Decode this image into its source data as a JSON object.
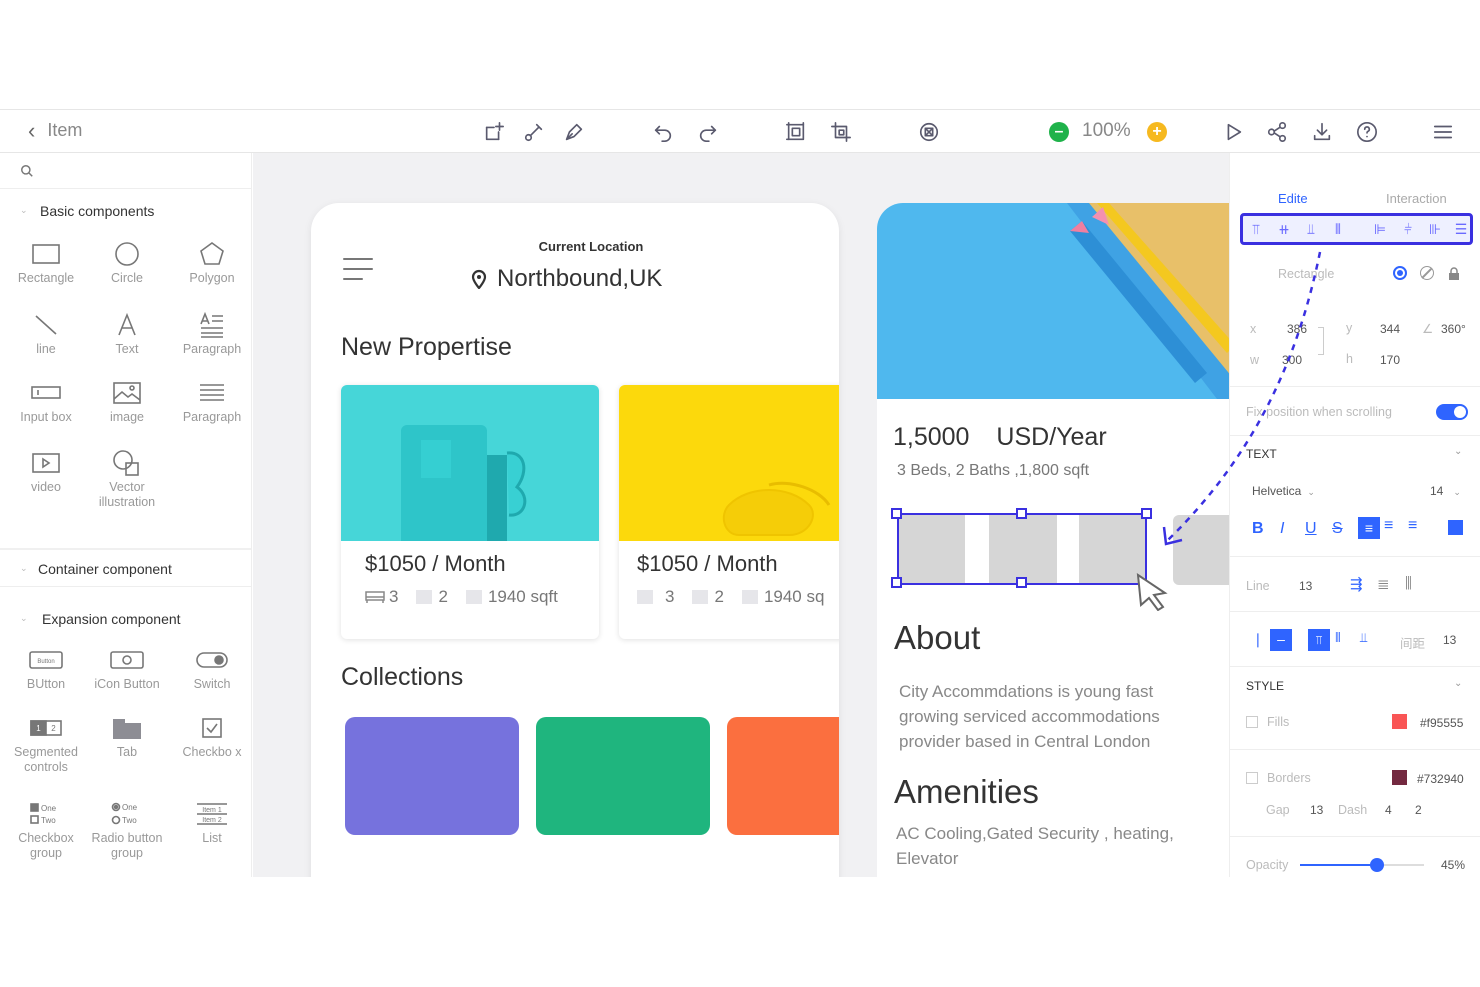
{
  "toolbar": {
    "back_label": "Item",
    "zoom": "100%",
    "icons": [
      "add-artboard-icon",
      "pen-icon",
      "brush-icon",
      "undo-icon",
      "redo-icon",
      "frame-icon",
      "crop-icon",
      "component-icon",
      "zoom-out-icon",
      "zoom-in-icon",
      "play-icon",
      "share-icon",
      "download-icon",
      "help-icon",
      "menu-icon"
    ]
  },
  "sidebar": {
    "basic_title": "Basic components",
    "basic_items": [
      {
        "label": "Rectangle",
        "icon": "rectangle-icon"
      },
      {
        "label": "Circle",
        "icon": "circle-icon"
      },
      {
        "label": "Polygon",
        "icon": "polygon-icon"
      },
      {
        "label": "line",
        "icon": "line-icon"
      },
      {
        "label": "Text",
        "icon": "text-icon"
      },
      {
        "label": "Paragraph",
        "icon": "paragraph-icon"
      },
      {
        "label": "Input box",
        "icon": "input-box-icon"
      },
      {
        "label": "image",
        "icon": "image-icon"
      },
      {
        "label": "Paragraph",
        "icon": "paragraph-lines-icon"
      },
      {
        "label": "video",
        "icon": "video-icon"
      },
      {
        "label": "Vector illustration",
        "icon": "vector-icon"
      }
    ],
    "container_title": "Container component",
    "expansion_title": "Expansion component",
    "expansion_items": [
      {
        "label": "BUtton",
        "icon": "button-icon",
        "inner": "Button"
      },
      {
        "label": "iCon Button",
        "icon": "icon-button-icon"
      },
      {
        "label": "Switch",
        "icon": "switch-icon"
      },
      {
        "label": "Segmented controls",
        "icon": "segmented-icon",
        "inner": [
          "1",
          "2"
        ]
      },
      {
        "label": "Tab",
        "icon": "tab-icon"
      },
      {
        "label": "Checkbo x",
        "icon": "checkbox-icon"
      },
      {
        "label": "Checkbox group",
        "icon": "checkbox-group-icon",
        "inner": [
          "One",
          "Two"
        ]
      },
      {
        "label": "Radio button group",
        "icon": "radio-group-icon",
        "inner": [
          "One",
          "Two"
        ]
      },
      {
        "label": "List",
        "icon": "list-icon",
        "inner": [
          "Item 1",
          "Item 2"
        ]
      }
    ]
  },
  "phone1": {
    "location_label": "Current Location",
    "location": "Northbound,UK",
    "section_title": "New Propertise",
    "cards": [
      {
        "price": "$1050 / Month",
        "beds": "3",
        "baths": "2",
        "area": "1940 sqft",
        "color": "#46d6d8"
      },
      {
        "price": "$1050 / Month",
        "beds": "3",
        "baths": "2",
        "area": "1940 sq",
        "color": "#fcd90c"
      }
    ],
    "collections_title": "Collections",
    "collection_colors": [
      "#7672dd",
      "#1fb57e",
      "#fb6f3f"
    ]
  },
  "phone2": {
    "price": "1,5000",
    "period": "USD/Year",
    "details": "3 Beds, 2 Baths ,1,800 sqft",
    "about_title": "About",
    "about_text": "City Accommdations  is young fast growing serviced accommodations provider based in Central London",
    "amenities_title": "Amenities",
    "amenities_text": "AC Cooling,Gated Security , heating, Elevator"
  },
  "panel": {
    "tab_edit": "Edite",
    "tab_interaction": "Interaction",
    "element_name": "Rectangle",
    "x_label": "x",
    "x_value": "386",
    "y_label": "y",
    "y_value": "344",
    "angle_value": "360°",
    "w_label": "w",
    "w_value": "300",
    "h_label": "h",
    "h_value": "170",
    "fix_position_label": "Fix position when scrolling",
    "text_section": "TEXT",
    "font": "Helvetica",
    "font_size": "14",
    "line_label": "Line",
    "line_value": "13",
    "spacing_label": "间距",
    "spacing_value": "13",
    "style_section": "STYLE",
    "fills_label": "Fills",
    "fills_value": "#f95555",
    "fills_color": "#f95555",
    "borders_label": "Borders",
    "borders_value": "#732940",
    "borders_color": "#732940",
    "gap_label": "Gap",
    "gap_value": "13",
    "dash_label": "Dash",
    "dash_value": "4",
    "dash_value2": "2",
    "opacity_label": "Opacity",
    "opacity_value": "45%",
    "opacity_fraction": 0.62,
    "accent": "#2f64ff"
  }
}
